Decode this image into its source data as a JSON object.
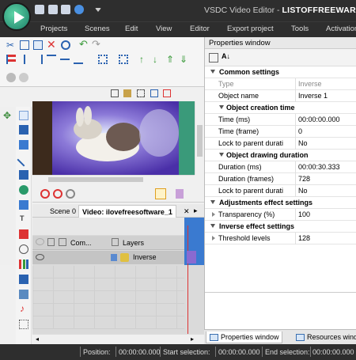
{
  "window": {
    "app_title": "VSDC Video Editor - ",
    "project_name": "LISTOFFREEWARE"
  },
  "menu": [
    "Projects",
    "Scenes",
    "Edit",
    "View",
    "Editor",
    "Export project",
    "Tools",
    "Activation"
  ],
  "tabs": {
    "scene": "Scene 0",
    "video": "Video: ilovefreesoftware_1"
  },
  "timeline": {
    "com_label": "Com...",
    "layers_label": "Layers",
    "track_name": "Inverse"
  },
  "properties": {
    "title": "Properties window",
    "sections": {
      "common": "Common settings",
      "creation": "Object creation time",
      "drawing": "Object drawing duration",
      "adjust": "Adjustments effect settings",
      "inverse": "Inverse effect settings"
    },
    "rows": {
      "type_k": "Type",
      "type_v": "Inverse",
      "name_k": "Object name",
      "name_v": "Inverse 1",
      "time_ms_k": "Time (ms)",
      "time_ms_v": "00:00:00.000",
      "time_frame_k": "Time (frame)",
      "time_frame_v": "0",
      "lock1_k": "Lock to parent durati",
      "lock1_v": "No",
      "dur_ms_k": "Duration (ms)",
      "dur_ms_v": "00:00:30.333",
      "dur_fr_k": "Duration (frames)",
      "dur_fr_v": "728",
      "lock2_k": "Lock to parent durati",
      "lock2_v": "No",
      "transp_k": "Transparency (%)",
      "transp_v": "100",
      "thresh_k": "Threshold levels",
      "thresh_v": "128"
    }
  },
  "bottom_tabs": {
    "properties": "Properties window",
    "resources": "Resources windo"
  },
  "status": {
    "position_label": "Position:",
    "position_value": "00:00:00.000",
    "start_label": "Start selection:",
    "start_value": "00:00:00.000",
    "end_label": "End selection:",
    "end_value": "00:00:00.000"
  }
}
